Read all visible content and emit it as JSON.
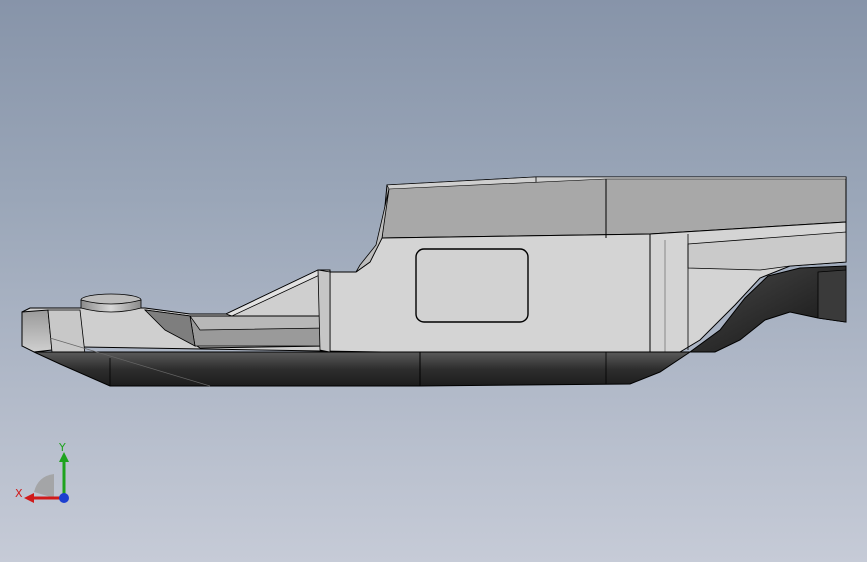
{
  "viewport": {
    "background_top": "#8794a9",
    "background_bottom": "#c6cbd7"
  },
  "model": {
    "type": "3d-part-side-view",
    "colors": {
      "face_light": "#d6d6d6",
      "face_mid": "#c2c2c2",
      "face_top": "#a9a9a9",
      "face_dark": "#3a3a3a",
      "edge": "#000000"
    }
  },
  "triad": {
    "x_label": "X",
    "y_label": "Y",
    "x_color": "#d01a1a",
    "y_color": "#1ea31e",
    "z_color": "#1c3fd0"
  }
}
